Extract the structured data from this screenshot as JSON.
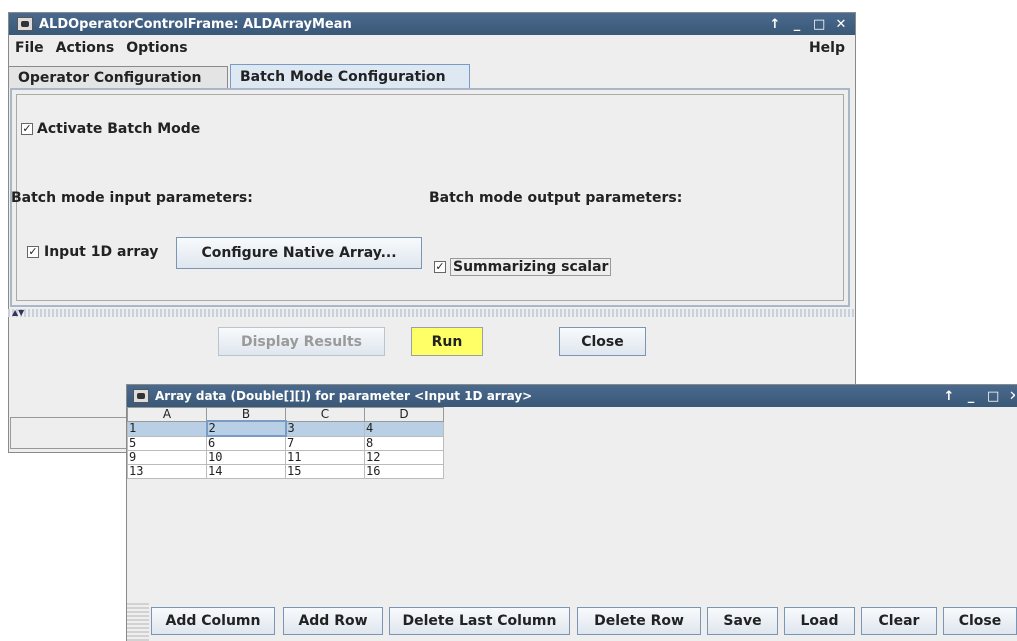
{
  "main_window": {
    "title": "ALDOperatorControlFrame: ALDArrayMean",
    "controls": [
      "↑",
      "_",
      "□",
      "✕"
    ],
    "menu": {
      "file": "File",
      "actions": "Actions",
      "options": "Options",
      "help": "Help"
    },
    "tabs": [
      "Operator Configuration",
      "Batch Mode Configuration"
    ],
    "active_tab": "Batch Mode Configuration",
    "batch": {
      "activate_label": "Activate Batch Mode",
      "activate_checked": true,
      "input_heading": "Batch mode input parameters:",
      "output_heading": "Batch mode output parameters:",
      "input_item_label": "Input 1D array",
      "input_item_checked": true,
      "configure_button": "Configure Native Array...",
      "output_item_label": "Summarizing scalar",
      "output_item_checked": true
    },
    "buttons": {
      "display_results": "Display Results",
      "run": "Run",
      "close": "Close"
    }
  },
  "array_window": {
    "title": "Array data (Double[][]) for parameter <Input 1D array>",
    "controls": [
      "↑",
      "_",
      "□",
      "✕"
    ],
    "columns": [
      "A",
      "B",
      "C",
      "D"
    ],
    "rows": [
      [
        "1",
        "2",
        "3",
        "4"
      ],
      [
        "5",
        "6",
        "7",
        "8"
      ],
      [
        "9",
        "10",
        "11",
        "12"
      ],
      [
        "13",
        "14",
        "15",
        "16"
      ]
    ],
    "selected_row": 0,
    "focused_cell": "B1",
    "buttons": [
      "Add Column",
      "Add Row",
      "Delete Last Column",
      "Delete Row",
      "Save",
      "Load",
      "Clear",
      "Close"
    ]
  },
  "colors": {
    "titlebar": "#3f5f82",
    "run_button": "#ffff66",
    "selection": "#b8cfe5",
    "window_bg": "#eeeeee"
  }
}
